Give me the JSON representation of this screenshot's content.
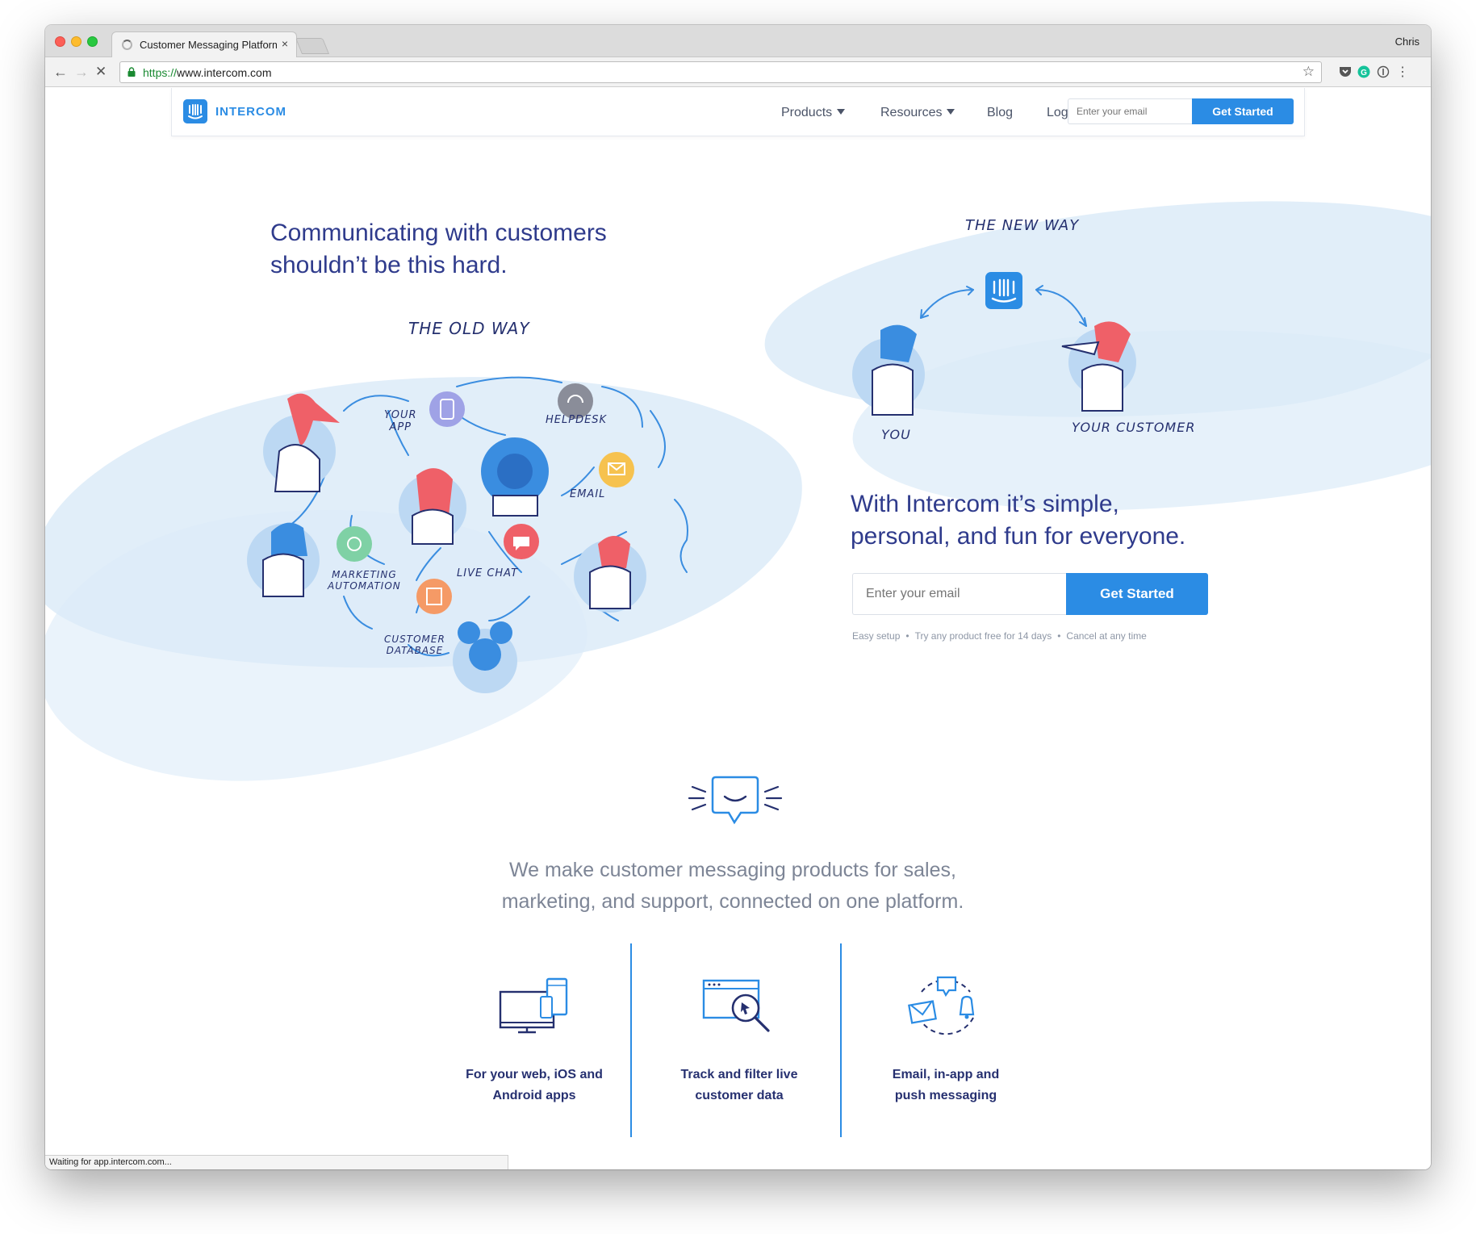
{
  "browser": {
    "tab_title": "Customer Messaging Platform",
    "tab_close": "×",
    "profile_name": "Chris",
    "url_scheme": "https://",
    "url_host": "www.intercom.com",
    "status_text": "Waiting for app.intercom.com..."
  },
  "site_nav": {
    "logo_text": "INTERCOM",
    "products_label": "Products",
    "resources_label": "Resources",
    "blog_label": "Blog",
    "login_label": "Log in",
    "email_placeholder": "Enter your email",
    "cta_label": "Get Started"
  },
  "hero": {
    "title_line1": "Communicating with customers",
    "title_line2": "shouldn’t be this hard.",
    "old_way": "THE OLD WAY",
    "new_way": "THE NEW WAY",
    "old_labels": {
      "your_app_1": "YOUR",
      "your_app_2": "APP",
      "helpdesk": "HELPDESK",
      "email": "EMAIL",
      "live_chat": "LIVE CHAT",
      "marketing_1": "MARKETING",
      "marketing_2": "AUTOMATION",
      "database_1": "CUSTOMER",
      "database_2": "DATABASE"
    },
    "you_label": "YOU",
    "your_customer_label": "YOUR CUSTOMER",
    "simple_line1": "With Intercom it’s simple,",
    "simple_line2": "personal, and fun for everyone.",
    "email_placeholder": "Enter your email",
    "cta_label": "Get Started",
    "fine_print": [
      "Easy setup",
      "Try any product free for 14 days",
      "Cancel at any time"
    ],
    "fine_print_separator": "•"
  },
  "statement": {
    "line1": "We make customer messaging products for sales,",
    "line2": "marketing, and support, connected on one platform."
  },
  "features": [
    {
      "line1": "For your web, iOS and",
      "line2": "Android apps",
      "icon": "devices-icon"
    },
    {
      "line1": "Track and filter live",
      "line2": "customer data",
      "icon": "magnifier-browser-icon"
    },
    {
      "line1": "Email, in-app and",
      "line2": "push messaging",
      "icon": "messaging-cycle-icon"
    }
  ],
  "colors": {
    "brand_blue": "#2b8ce4",
    "navy": "#2f3b8c",
    "wash": "#dcebf8",
    "coral": "#ef6068"
  }
}
